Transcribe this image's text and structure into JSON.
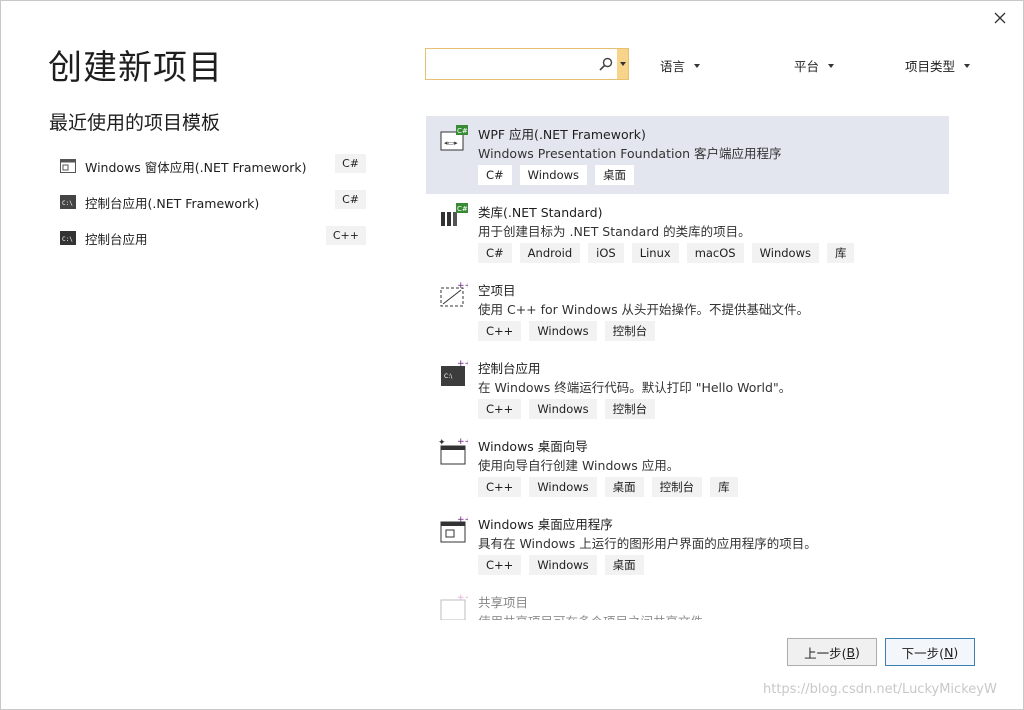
{
  "dialog": {
    "title": "创建新项目",
    "close_icon": "close-icon"
  },
  "recent": {
    "title": "最近使用的项目模板",
    "items": [
      {
        "label": "Windows 窗体应用(.NET Framework)",
        "lang": "C#",
        "icon": "winforms-icon"
      },
      {
        "label": "控制台应用(.NET Framework)",
        "lang": "C#",
        "icon": "console-icon"
      },
      {
        "label": "控制台应用",
        "lang": "C++",
        "icon": "console-icon"
      }
    ]
  },
  "search": {
    "value": "",
    "placeholder": ""
  },
  "filters": {
    "language": "语言",
    "platform": "平台",
    "project_type": "项目类型"
  },
  "templates": [
    {
      "name": "WPF 应用(.NET Framework)",
      "desc": "Windows Presentation Foundation 客户端应用程序",
      "tags": [
        "C#",
        "Windows",
        "桌面"
      ],
      "icon": "wpf-icon",
      "selected": true
    },
    {
      "name": "类库(.NET Standard)",
      "desc": "用于创建目标为 .NET Standard 的类库的项目。",
      "tags": [
        "C#",
        "Android",
        "iOS",
        "Linux",
        "macOS",
        "Windows",
        "库"
      ],
      "icon": "class-library-icon"
    },
    {
      "name": "空项目",
      "desc": "使用 C++ for Windows 从头开始操作。不提供基础文件。",
      "tags": [
        "C++",
        "Windows",
        "控制台"
      ],
      "icon": "empty-project-icon"
    },
    {
      "name": "控制台应用",
      "desc": "在 Windows 终端运行代码。默认打印 \"Hello World\"。",
      "tags": [
        "C++",
        "Windows",
        "控制台"
      ],
      "icon": "console-app-icon"
    },
    {
      "name": "Windows 桌面向导",
      "desc": "使用向导自行创建 Windows 应用。",
      "tags": [
        "C++",
        "Windows",
        "桌面",
        "控制台",
        "库"
      ],
      "icon": "desktop-wizard-icon"
    },
    {
      "name": "Windows 桌面应用程序",
      "desc": "具有在 Windows 上运行的图形用户界面的应用程序的项目。",
      "tags": [
        "C++",
        "Windows",
        "桌面"
      ],
      "icon": "desktop-app-icon"
    },
    {
      "name": "共享项目",
      "desc": "使用共享项目可在多个项目之间共享文件。",
      "tags": [],
      "icon": "shared-project-icon",
      "faded": true
    }
  ],
  "buttons": {
    "back": {
      "label": "上一步(",
      "key": "B",
      "suffix": ")"
    },
    "next": {
      "label": "下一步(",
      "key": "N",
      "suffix": ")"
    }
  },
  "watermark": "https://blog.csdn.net/LuckyMickeyW",
  "colors": {
    "selected_bg": "#e3e6ef",
    "tag_bg": "#f2f2f2",
    "search_border": "#e8c074",
    "primary_border": "#3c7fb1",
    "csharp_badge": "#388a34",
    "cpp_badge": "#68217a"
  }
}
